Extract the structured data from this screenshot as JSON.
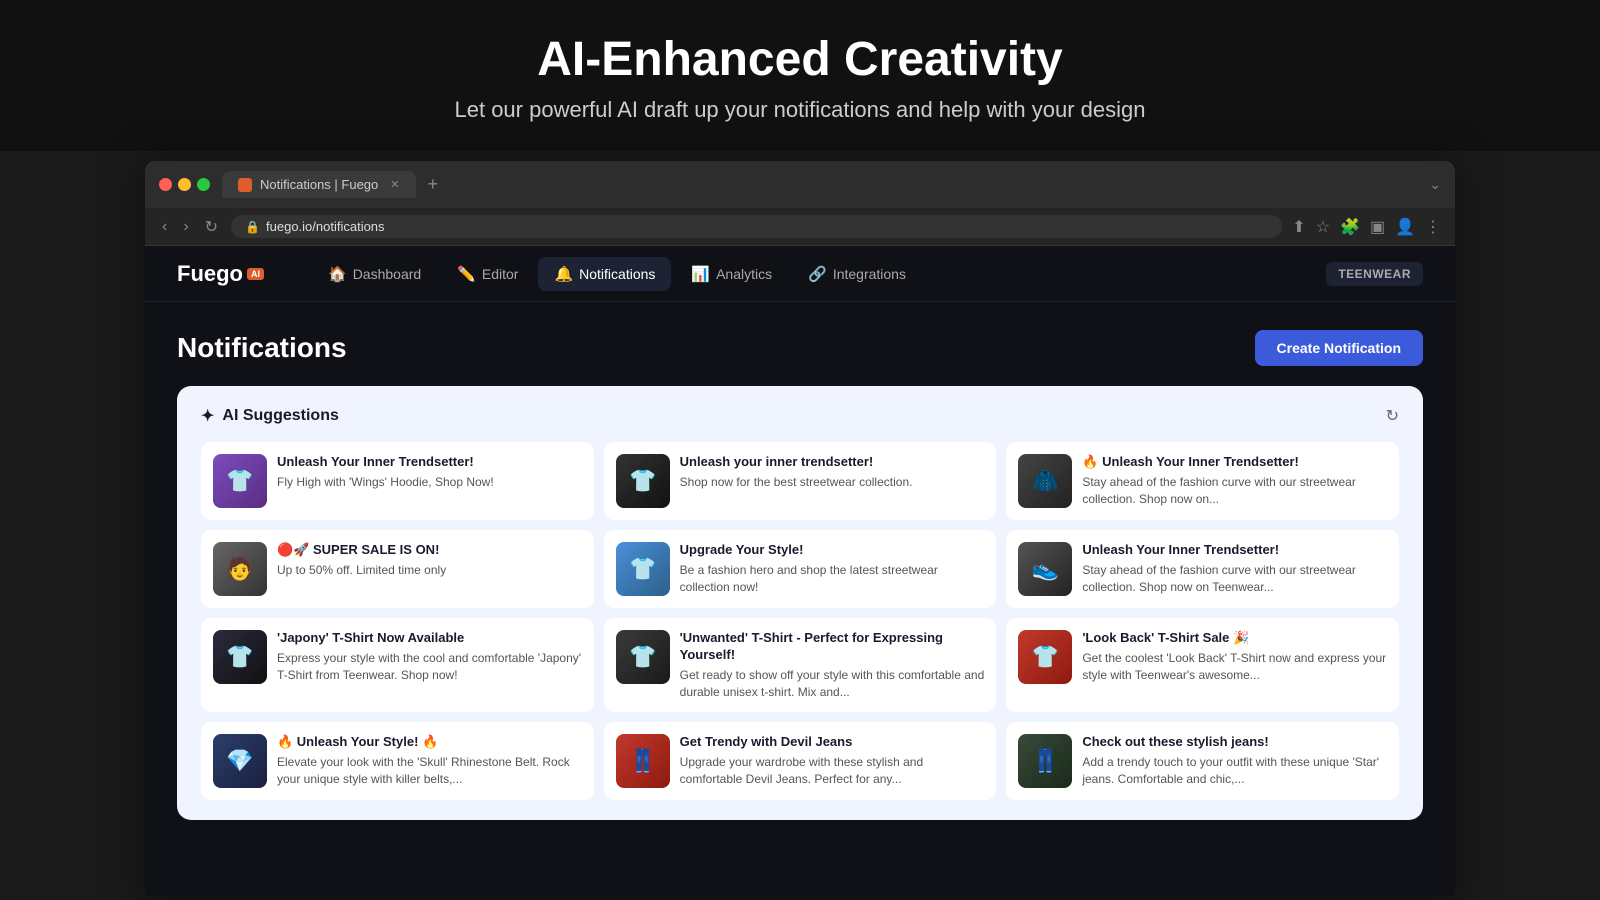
{
  "hero": {
    "title": "AI-Enhanced Creativity",
    "subtitle": "Let our powerful AI draft up your notifications and help with your design"
  },
  "browser": {
    "tab_title": "Notifications | Fuego",
    "url": "fuego.io/notifications",
    "new_tab_label": "+"
  },
  "nav": {
    "logo": "Fuego",
    "logo_badge": "AI",
    "items": [
      {
        "label": "Dashboard",
        "icon": "🏠",
        "active": false
      },
      {
        "label": "Editor",
        "icon": "✏️",
        "active": false
      },
      {
        "label": "Notifications",
        "icon": "🔔",
        "active": true
      },
      {
        "label": "Analytics",
        "icon": "📊",
        "active": false
      },
      {
        "label": "Integrations",
        "icon": "🔗",
        "active": false
      }
    ],
    "user_badge": "TEENWEAR"
  },
  "page": {
    "title": "Notifications",
    "create_button": "Create Notification"
  },
  "ai_suggestions": {
    "section_title": "AI Suggestions",
    "icon": "✦",
    "refresh_icon": "↻",
    "cards": [
      {
        "thumb_class": "thumb-purple",
        "thumb_emoji": "👕",
        "title": "Unleash Your Inner Trendsetter!",
        "desc": "Fly High with 'Wings' Hoodie, Shop Now!"
      },
      {
        "thumb_class": "thumb-black",
        "thumb_emoji": "👕",
        "title": "Unleash your inner trendsetter!",
        "desc": "Shop now for the best streetwear collection."
      },
      {
        "thumb_class": "thumb-dark",
        "thumb_emoji": "🧥",
        "title": "🔥 Unleash Your Inner Trendsetter!",
        "desc": "Stay ahead of the fashion curve with our streetwear collection. Shop now on..."
      },
      {
        "thumb_class": "thumb-grey",
        "thumb_emoji": "🧑",
        "title": "🔴🚀 SUPER SALE IS ON!",
        "desc": "Up to 50% off. Limited time only"
      },
      {
        "thumb_class": "thumb-blue",
        "thumb_emoji": "👕",
        "title": "Upgrade Your Style!",
        "desc": "Be a fashion hero and shop the latest streetwear collection now!"
      },
      {
        "thumb_class": "thumb-darkgrey",
        "thumb_emoji": "👟",
        "title": "Unleash Your Inner Trendsetter!",
        "desc": "Stay ahead of the fashion curve with our streetwear collection. Shop now on Teenwear..."
      },
      {
        "thumb_class": "thumb-tshirt",
        "thumb_emoji": "👕",
        "title": "'Japony' T-Shirt Now Available",
        "desc": "Express your style with the cool and comfortable 'Japony' T-Shirt from Teenwear. Shop now!"
      },
      {
        "thumb_class": "thumb-graphite",
        "thumb_emoji": "👕",
        "title": "'Unwanted' T-Shirt - Perfect for Expressing Yourself!",
        "desc": "Get ready to show off your style with this comfortable and durable unisex t-shirt. Mix and..."
      },
      {
        "thumb_class": "thumb-red",
        "thumb_emoji": "👕",
        "title": "'Look Back' T-Shirt Sale 🎉",
        "desc": "Get the coolest 'Look Back' T-Shirt now and express your style with Teenwear's awesome..."
      },
      {
        "thumb_class": "thumb-darkblue",
        "thumb_emoji": "💎",
        "title": "🔥 Unleash Your Style! 🔥",
        "desc": "Elevate your look with the 'Skull' Rhinestone Belt. Rock your unique style with killer belts,..."
      },
      {
        "thumb_class": "thumb-jeans",
        "thumb_emoji": "👖",
        "title": "Get Trendy with Devil Jeans",
        "desc": "Upgrade your wardrobe with these stylish and comfortable Devil Jeans. Perfect for any..."
      },
      {
        "thumb_class": "thumb-star",
        "thumb_emoji": "👖",
        "title": "Check out these stylish jeans!",
        "desc": "Add a trendy touch to your outfit with these unique 'Star' jeans. Comfortable and chic,..."
      }
    ]
  }
}
